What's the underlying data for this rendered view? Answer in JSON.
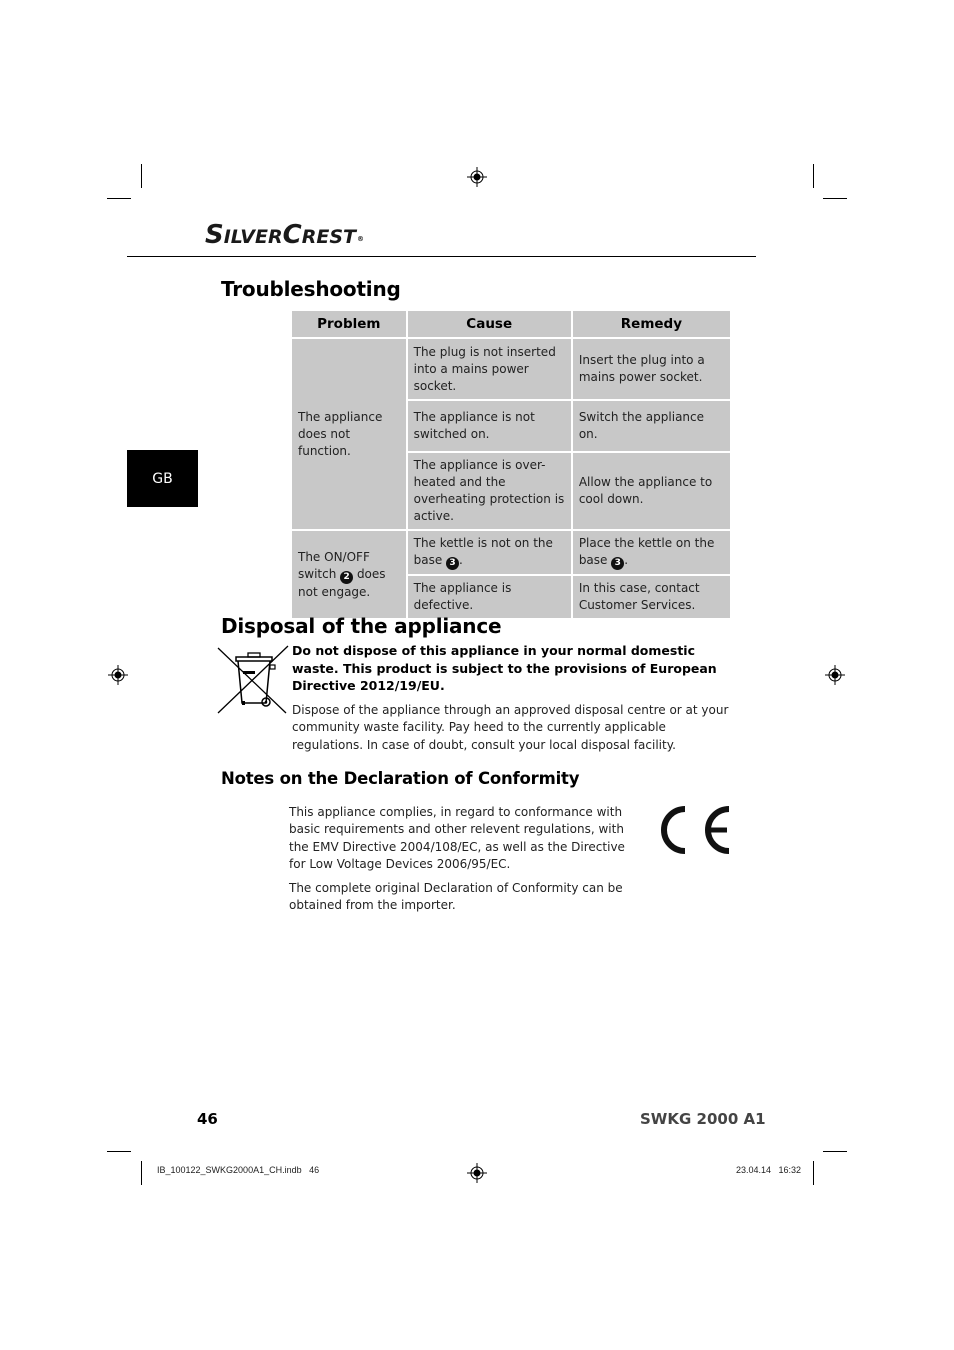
{
  "header": {
    "brand_main": "S",
    "brand_rest1": "ILVER",
    "brand_c": "C",
    "brand_rest2": "REST",
    "brand_reg": "®"
  },
  "side_tab": {
    "label": "GB"
  },
  "troubleshooting": {
    "title": "Troubleshooting",
    "columns": [
      "Problem",
      "Cause",
      "Remedy"
    ],
    "groups": [
      {
        "problem": "The appliance does not function.",
        "rows": [
          {
            "cause": "The plug is not inserted into a mains power socket.",
            "remedy": "Insert the plug into a mains power socket."
          },
          {
            "cause": "The appliance is not switched on.",
            "remedy": "Switch the appliance on."
          },
          {
            "cause": "The appliance is over-heated and the overheating protection is active.",
            "remedy": "Allow the appliance to cool down."
          }
        ]
      },
      {
        "problem_before": "The ON/OFF switch ",
        "problem_ref": "2",
        "problem_after": " does not engage.",
        "rows": [
          {
            "cause_before": "The kettle is not on the base ",
            "cause_ref": "3",
            "cause_after": ".",
            "remedy_before": "Place the kettle on the base ",
            "remedy_ref": "3",
            "remedy_after": "."
          },
          {
            "cause": "The appliance is defective.",
            "remedy": "In this case, contact Customer Services."
          }
        ]
      }
    ]
  },
  "disposal": {
    "title": "Disposal of the appliance",
    "icon": "crossed-out-wheelie-bin-icon",
    "warning": "Do not dispose of this appliance in your normal domestic waste. This product is subject to the provisions of European Directive 2012/19/EU.",
    "text": "Dispose of the appliance through an approved disposal centre or at your community waste facility. Pay heed to the currently applicable regulations. In case of doubt, consult your local disposal facility."
  },
  "conformity": {
    "title": "Notes on the Declaration of Conformity",
    "para1": "This appliance complies, in regard to conformance with basic requirements and other relevent regulations, with the EMV Directive 2004/108/EC, as well as the Directive for Low Voltage Devices 2006/95/EC.",
    "para2": "The complete original Declaration of Conformity can be obtained from the importer.",
    "mark": "CE"
  },
  "footer": {
    "page_number": "46",
    "model": "SWKG 2000 A1",
    "slug_file": "IB_100122_SWKG2000A1_CH.indb   46",
    "slug_date": "23.04.14   16:32"
  }
}
